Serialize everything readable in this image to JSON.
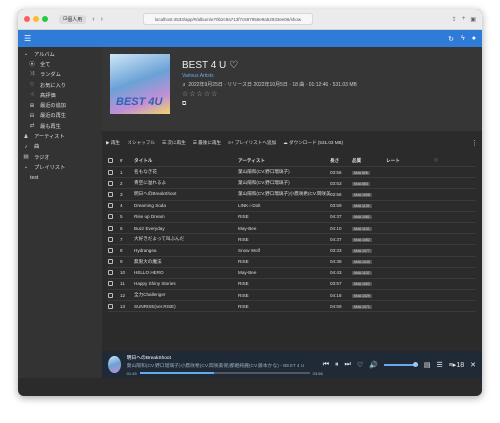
{
  "browser": {
    "profile": "個人用",
    "url": "localhost:4533/app/#/album/e70b2c9a713f7c597955e9a52933ee06/show"
  },
  "sidebar": {
    "albums_label": "アルバム",
    "items": [
      "全て",
      "ランダム",
      "お気に入り",
      "高評価",
      "最近の追加",
      "最近の再生",
      "最も再生"
    ],
    "artists_label": "アーティスト",
    "songs_label": "曲",
    "radio_label": "ラジオ",
    "playlists_label": "プレイリスト",
    "playlist_item": "test"
  },
  "album": {
    "title": "BEST 4 U",
    "cover_text": "BEST 4U",
    "artist": "Various Artists",
    "info": "♬ 2022年9月25日 · リリース日 2022年10月5日 · 18 曲 · 01:12:46 · 531.03 MB",
    "stars": "☆☆☆☆☆"
  },
  "actions": {
    "play": "再生",
    "shuffle": "シャッフル",
    "play_next": "次に再生",
    "play_last": "最後に再生",
    "add_playlist": "プレイリストへ追加",
    "download": "ダウンロード (531.03 MB)"
  },
  "table": {
    "headers": {
      "num": "#",
      "title": "タイトル",
      "artist": "アーティスト",
      "length": "長さ",
      "quality": "品質",
      "rating": "レート"
    },
    "rows": [
      {
        "n": "1",
        "title": "名もなき花",
        "artist": "葉山陽和(CV.野口瑠璃子)",
        "len": "03:56",
        "q": "M4A 826"
      },
      {
        "n": "2",
        "title": "青空に溢れるよ",
        "artist": "葉山陽和(CV.野口瑠璃子)",
        "len": "03:53",
        "q": "M4A 853"
      },
      {
        "n": "3",
        "title": "明日へのBreakShoot",
        "artist": "葉山陽和(CV.野口瑠璃子)小鷹咲希(CV.岡咲美保)都姫純麗(CV.藤本かな)",
        "len": "03:56",
        "q": "M4A 1098"
      },
      {
        "n": "4",
        "title": "Dreaming Soda",
        "artist": "LINK☆Dolt",
        "len": "03:59",
        "q": "M4A 1125"
      },
      {
        "n": "5",
        "title": "Rise up Dream",
        "artist": "RISE",
        "len": "04:37",
        "q": "M4A 1081"
      },
      {
        "n": "6",
        "title": "Buzz Everyday",
        "artist": "May-Bee",
        "len": "04:10",
        "q": "M4A 1102"
      },
      {
        "n": "7",
        "title": "大好きだよって叫ぶんだ",
        "artist": "RISE",
        "len": "04:37",
        "q": "M4A 1082"
      },
      {
        "n": "8",
        "title": "Hydrangea",
        "artist": "Snow Wolf",
        "len": "03:33",
        "q": "M4A 1077"
      },
      {
        "n": "9",
        "title": "無限大の魔法",
        "artist": "RISE",
        "len": "04:38",
        "q": "M4A 1040"
      },
      {
        "n": "10",
        "title": "HELLO HERO",
        "artist": "May-Bee",
        "len": "04:43",
        "q": "M4A 1102"
      },
      {
        "n": "11",
        "title": "Happy Shiny Stories",
        "artist": "RISE",
        "len": "03:57",
        "q": "M4A 1062"
      },
      {
        "n": "12",
        "title": "全力Challenger",
        "artist": "RISE",
        "len": "04:18",
        "q": "M4A 1029"
      },
      {
        "n": "13",
        "title": "SUNRISE(ver.RISE)",
        "artist": "RISE",
        "len": "04:59",
        "q": "M4A 1071"
      }
    ]
  },
  "player": {
    "title": "明日へのBreakShoot",
    "artist": "葉山陽和(CV.野口瑠璃子)小鷹咲希(CV.岡咲美保)都姫純麗(CV.藤本かな) - BEST 4 U",
    "elapsed": "01:45",
    "total": "03:56",
    "progress": 0.44,
    "queue_count": "18"
  }
}
